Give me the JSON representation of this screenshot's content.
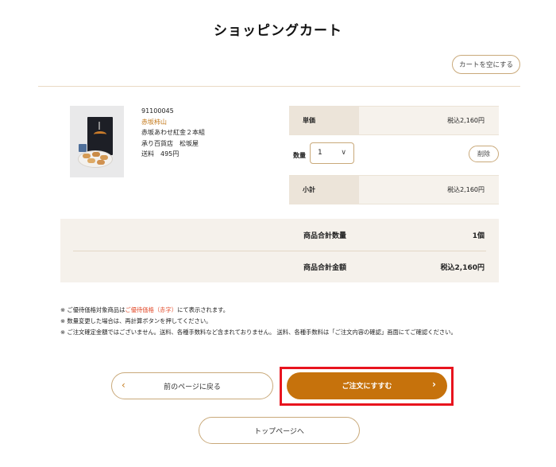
{
  "page": {
    "title": "ショッピングカート"
  },
  "cart_actions": {
    "empty_cart_label": "カートを空にする"
  },
  "item": {
    "code": "91100045",
    "brand": "赤坂柿山",
    "name": "赤坂あわせ紅金２本組",
    "seller": "承り百貨店　松坂屋",
    "shipping": "送料　495円",
    "unit_price_label": "単価",
    "unit_price_value": "税込2,160円",
    "quantity_label": "数量",
    "quantity_value": "1",
    "delete_label": "削除",
    "subtotal_label": "小計",
    "subtotal_value": "税込2,160円"
  },
  "totals": {
    "count_label": "商品合計数量",
    "count_value": "1個",
    "amount_label": "商品合計金額",
    "amount_value": "税込2,160円"
  },
  "notes": {
    "note1_prefix": "※ ご優待価格対象商品は",
    "note1_red": "ご優待価格（赤字）",
    "note1_suffix": "にて表示されます。",
    "note2": "※ 数量変更した場合は、再計算ボタンを押してください。",
    "note3": "※ ご注文確定金額ではございません。送料、各種手数料など含まれておりません。 送料、各種手数料は「ご注文内容の確認」画面にてご確認ください。"
  },
  "buttons": {
    "back_label": "前のページに戻る",
    "order_label": "ご注文にすすむ",
    "top_label": "トップページへ"
  },
  "colors": {
    "accent": "#c6720c",
    "highlight": "#e8141e",
    "brand_text": "#c47a1c",
    "note_red": "#e24b2b"
  },
  "icons": {
    "back_arrow": "chevron-left-icon",
    "order_arrow": "chevron-right-icon",
    "select_arrow": "chevron-down-icon"
  }
}
